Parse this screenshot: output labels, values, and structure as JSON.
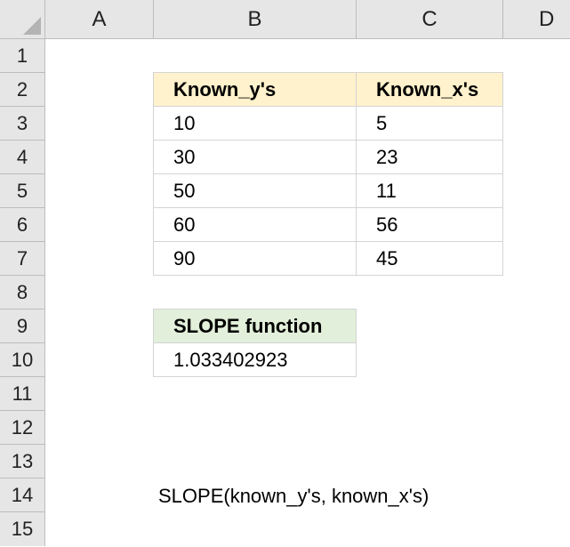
{
  "columns": [
    "A",
    "B",
    "C",
    "D"
  ],
  "rows": [
    "1",
    "2",
    "3",
    "4",
    "5",
    "6",
    "7",
    "8",
    "9",
    "10",
    "11",
    "12",
    "13",
    "14",
    "15"
  ],
  "table1": {
    "headers": [
      "Known_y's",
      "Known_x's"
    ],
    "rows": [
      [
        "10",
        "5"
      ],
      [
        "30",
        "23"
      ],
      [
        "50",
        "11"
      ],
      [
        "60",
        "56"
      ],
      [
        "90",
        "45"
      ]
    ],
    "header_color": "#fff2cc"
  },
  "table2": {
    "header": "SLOPE function",
    "value": "1.033402923",
    "header_color": "#e2efda"
  },
  "formula_note": "SLOPE(known_y's, known_x's)"
}
